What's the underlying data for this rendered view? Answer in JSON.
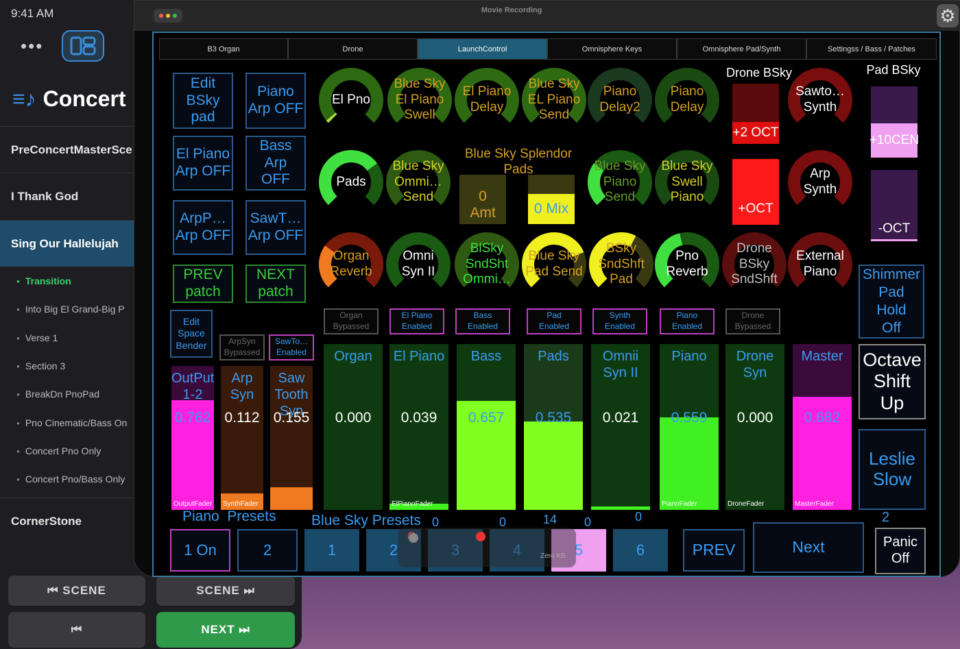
{
  "status_time": "9:41 AM",
  "app": {
    "title": "Concert",
    "window_title": "Movie Recording"
  },
  "songs": [
    {
      "label": "PreConcertMasterSce",
      "active": false
    },
    {
      "label": "I Thank God",
      "active": false
    },
    {
      "label": "Sing Our Hallelujah",
      "active": true
    },
    {
      "label": "CornerStone",
      "active": false
    }
  ],
  "sections": [
    {
      "label": "Transition",
      "active": true
    },
    {
      "label": "Into Big El Grand-Big P",
      "active": false
    },
    {
      "label": "Verse 1",
      "active": false
    },
    {
      "label": "Section 3",
      "active": false
    },
    {
      "label": "BreakDn PnoPad",
      "active": false
    },
    {
      "label": "Pno Cinematic/Bass On",
      "active": false
    },
    {
      "label": "Concert Pno Only",
      "active": false
    },
    {
      "label": "Concert Pno/Bass Only",
      "active": false
    }
  ],
  "controls": {
    "prev_scene": "⏮ SCENE",
    "next_scene": "SCENE ⏭",
    "prev": "⏮",
    "next": "NEXT ⏭"
  },
  "tabs": [
    {
      "label": "B3 Organ",
      "active": false
    },
    {
      "label": "Drone",
      "active": false
    },
    {
      "label": "LaunchControl",
      "active": true
    },
    {
      "label": "Omnisphere Keys",
      "active": false
    },
    {
      "label": "Omnisphere Pad/Synth",
      "active": false
    },
    {
      "label": "Settingss / Bass / Patches",
      "active": false
    }
  ],
  "left_buttons": [
    {
      "label": "Edit\nBSky\npad"
    },
    {
      "label": "Piano\nArp OFF"
    },
    {
      "label": "El Piano\nArp OFF"
    },
    {
      "label": "Bass Arp\nOFF"
    },
    {
      "label": "ArpP…\nArp OFF"
    },
    {
      "label": "SawT…\nArp OFF"
    },
    {
      "label": "PREV\npatch"
    },
    {
      "label": "NEXT\npatch"
    }
  ],
  "knobs": [
    {
      "label": "El Pno",
      "value": 0.02,
      "color": "#2e6a12",
      "fill": "#b0e040",
      "text": "#ffffff"
    },
    {
      "label": "Blue Sky\nEl Piano\nSwell",
      "value": 0,
      "color": "#2e6a12",
      "fill": "#2e6a12",
      "text": "#d4a020"
    },
    {
      "label": "El Piano\nDelay",
      "value": 0,
      "color": "#2e6a12",
      "fill": "#2e6a12",
      "text": "#d4a020"
    },
    {
      "label": "Blue Sky\nEL Piano\nSend",
      "value": 0,
      "color": "#2e6a12",
      "fill": "#2e6a12",
      "text": "#d4a020"
    },
    {
      "label": "Piano\nDelay2",
      "value": 0,
      "color": "#1a3a20",
      "fill": "#1a3a20",
      "text": "#d4a020"
    },
    {
      "label": "Piano\nDelay",
      "value": 0,
      "color": "#1a4a12",
      "fill": "#1a4a12",
      "text": "#d4a020"
    },
    {
      "label": "Sawto…\nSynth",
      "value": 0,
      "color": "#7a0e0e",
      "fill": "#7a0e0e",
      "text": "#ffffff"
    },
    {
      "label": "Pads",
      "value": 0.7,
      "color": "#1a5a12",
      "fill": "#40e040",
      "text": "#ffffff"
    },
    {
      "label": "Blue Sky\nOmmi…\nSend",
      "value": 0,
      "color": "#2e5a12",
      "fill": "#2e5a12",
      "text": "#d4d020"
    },
    {
      "label": "Blue Sky\nPiano\nSend",
      "value": 0.3,
      "color": "#1a5a12",
      "fill": "#40e040",
      "text": "#6a9a2a"
    },
    {
      "label": "Blue Sky\nSwell\nPiano",
      "value": 0,
      "color": "#1a4a12",
      "fill": "#1a4a12",
      "text": "#d4d020"
    },
    {
      "label": "Arp\nSynth",
      "value": 0,
      "color": "#7a0e0e",
      "fill": "#7a0e0e",
      "text": "#ffffff"
    },
    {
      "label": "Organ\nReverb",
      "value": 0.3,
      "color": "#7a1a0a",
      "fill": "#f07a20",
      "text": "#d4a020"
    },
    {
      "label": "Omni\nSyn II",
      "value": 0,
      "color": "#1a5a12",
      "fill": "#1a5a12",
      "text": "#ffffff"
    },
    {
      "label": "BlSky\nSndSht\nOmmi…",
      "value": 0,
      "color": "#2e5a12",
      "fill": "#2e5a12",
      "text": "#40e040"
    },
    {
      "label": "Blue Sky\nPad  Send",
      "value": 0.75,
      "color": "#3a3a12",
      "fill": "#f0f020",
      "text": "#d4a020"
    },
    {
      "label": "BSky\nSndShft\nPad",
      "value": 0.6,
      "color": "#3a3a12",
      "fill": "#f0f020",
      "text": "#d4a020"
    },
    {
      "label": "Pno\nReverb",
      "value": 0.45,
      "color": "#1a5a12",
      "fill": "#40e040",
      "text": "#ffffff"
    },
    {
      "label": "Drone\nBSky\nSndShft",
      "value": 0,
      "color": "#5a0e0e",
      "fill": "#5a0e0e",
      "text": "#c0c0c0"
    },
    {
      "label": "External\nPiano",
      "value": 0,
      "color": "#6a0e0e",
      "fill": "#6a0e0e",
      "text": "#ffffff"
    }
  ],
  "blue_sky_splendor": {
    "title": "Blue Sky Splendor\nPads",
    "amt": "0\nAmt",
    "mix": "0 Mix"
  },
  "drone": {
    "title": "Drone BSky",
    "up2": "+2 OCT",
    "up": "+OCT"
  },
  "pad": {
    "title": "Pad BSky",
    "cent": "+10CEN",
    "down": "-OCT"
  },
  "status_boxes": [
    {
      "label": "Organ\nBypassed",
      "enabled": false
    },
    {
      "label": "El Piano\nEnabled",
      "enabled": true
    },
    {
      "label": "Bass\nEnabled",
      "enabled": true
    },
    {
      "label": "Pad\nEnabled",
      "enabled": true
    },
    {
      "label": "Synth\nEnabled",
      "enabled": true
    },
    {
      "label": "Piano\nEnabled",
      "enabled": true
    },
    {
      "label": "Drone\nBypassed",
      "enabled": false
    }
  ],
  "edit_space_bender": "Edit\nSpace\nBender",
  "small_status": [
    {
      "label": "ArpSyn\nBypassed",
      "enabled": false
    },
    {
      "label": "SawTo…\nEnabled",
      "enabled": true
    }
  ],
  "faders": [
    {
      "name": "OutPut\n1-2",
      "value": "0.762",
      "level": 0.762,
      "foot": "OutputFader",
      "bg": "#3a0a3a",
      "fill": "#ff20e0",
      "text": "#3a9cf0"
    },
    {
      "name": "Arp\nSyn",
      "value": "0.112",
      "level": 0.112,
      "foot": "SynthFader",
      "bg": "#3a1a08",
      "fill": "#f07a20",
      "text": "#3a9cf0"
    },
    {
      "name": "Saw\nTooth\nSyn",
      "value": "0.155",
      "level": 0.155,
      "foot": "",
      "bg": "#3a1a08",
      "fill": "#f07a20",
      "text": "#3a9cf0"
    },
    {
      "name": "Organ",
      "value": "0.000",
      "level": 0,
      "foot": "",
      "bg": "#0f3a0f",
      "fill": "#40f020",
      "text": "#3a9cf0"
    },
    {
      "name": "El Piano",
      "value": "0.039",
      "level": 0.039,
      "foot": "ElPianoFader",
      "bg": "#0f3a0f",
      "fill": "#40f020",
      "text": "#3a9cf0"
    },
    {
      "name": "Bass",
      "value": "0.657",
      "level": 0.657,
      "foot": "",
      "bg": "#0f3a0f",
      "fill": "#80ff20",
      "text": "#3a9cf0"
    },
    {
      "name": "Pads",
      "value": "0.535",
      "level": 0.535,
      "foot": "",
      "bg": "#1a3a1a",
      "fill": "#80ff20",
      "text": "#3a9cf0"
    },
    {
      "name": "Omnii\nSyn II",
      "value": "0.021",
      "level": 0.021,
      "foot": "",
      "bg": "#0f3a0f",
      "fill": "#40f020",
      "text": "#3a9cf0"
    },
    {
      "name": "Piano",
      "value": "0.559",
      "level": 0.559,
      "foot": "PianoFader",
      "bg": "#0f3a0f",
      "fill": "#40f020",
      "text": "#3a9cf0"
    },
    {
      "name": "Drone\nSyn",
      "value": "0.000",
      "level": 0,
      "foot": "DroneFader",
      "bg": "#0f3a0f",
      "fill": "#40f020",
      "text": "#3a9cf0"
    },
    {
      "name": "Master",
      "value": "0.682",
      "level": 0.682,
      "foot": "MasterFader",
      "bg": "#3a0a3a",
      "fill": "#ff20e0",
      "text": "#3a9cf0"
    }
  ],
  "right_buttons": {
    "shimmer": "Shimmer\nPad\nHold\nOff",
    "octave": "Octave\nShift\nUp",
    "leslie": "Leslie\nSlow",
    "panic": "Panic\nOff",
    "panic_num": "2"
  },
  "presets": {
    "piano_title": "Piano  Presets",
    "bluesky_title": "Blue Sky Presets",
    "piano": [
      "1 On",
      "2"
    ],
    "bluesky": [
      "1",
      "2",
      "3",
      "4",
      "5",
      "6"
    ],
    "nums": [
      "0",
      "0",
      "14",
      "0",
      "0"
    ],
    "prev": "PREV",
    "next": "Next"
  },
  "overlay": {
    "size": "Zero KB"
  }
}
